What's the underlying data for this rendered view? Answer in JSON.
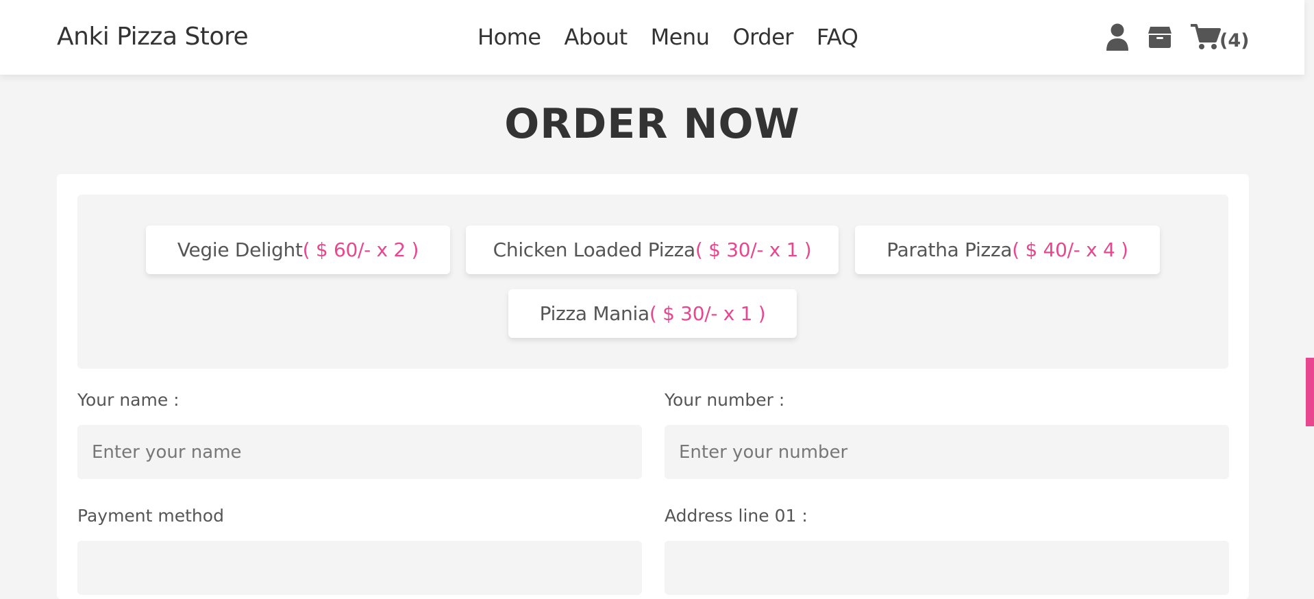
{
  "header": {
    "logo": "Anki Pizza Store",
    "nav": [
      "Home",
      "About",
      "Menu",
      "Order",
      "FAQ"
    ],
    "icons": [
      "user-icon",
      "box-icon",
      "cart-icon"
    ],
    "cart_count": "(4)"
  },
  "page": {
    "heading": "ORDER NOW"
  },
  "order_items": [
    {
      "name": "Vegie Delight ",
      "price": "( $ 60/- x 2 )"
    },
    {
      "name": "Chicken Loaded Pizza",
      "price": "( $ 30/- x 1 )"
    },
    {
      "name": "Paratha Pizza ",
      "price": "( $ 40/- x 4 )"
    },
    {
      "name": "Pizza Mania ",
      "price": "( $ 30/- x 1 )"
    }
  ],
  "form": {
    "name_label": "Your name :",
    "name_placeholder": "Enter your name",
    "number_label": "Your number :",
    "number_placeholder": "Enter your number",
    "payment_label": "Payment method",
    "address_label": "Address line 01 :"
  },
  "colors": {
    "accent": "#e8468f",
    "text": "#333333",
    "background": "#f4f4f4"
  }
}
